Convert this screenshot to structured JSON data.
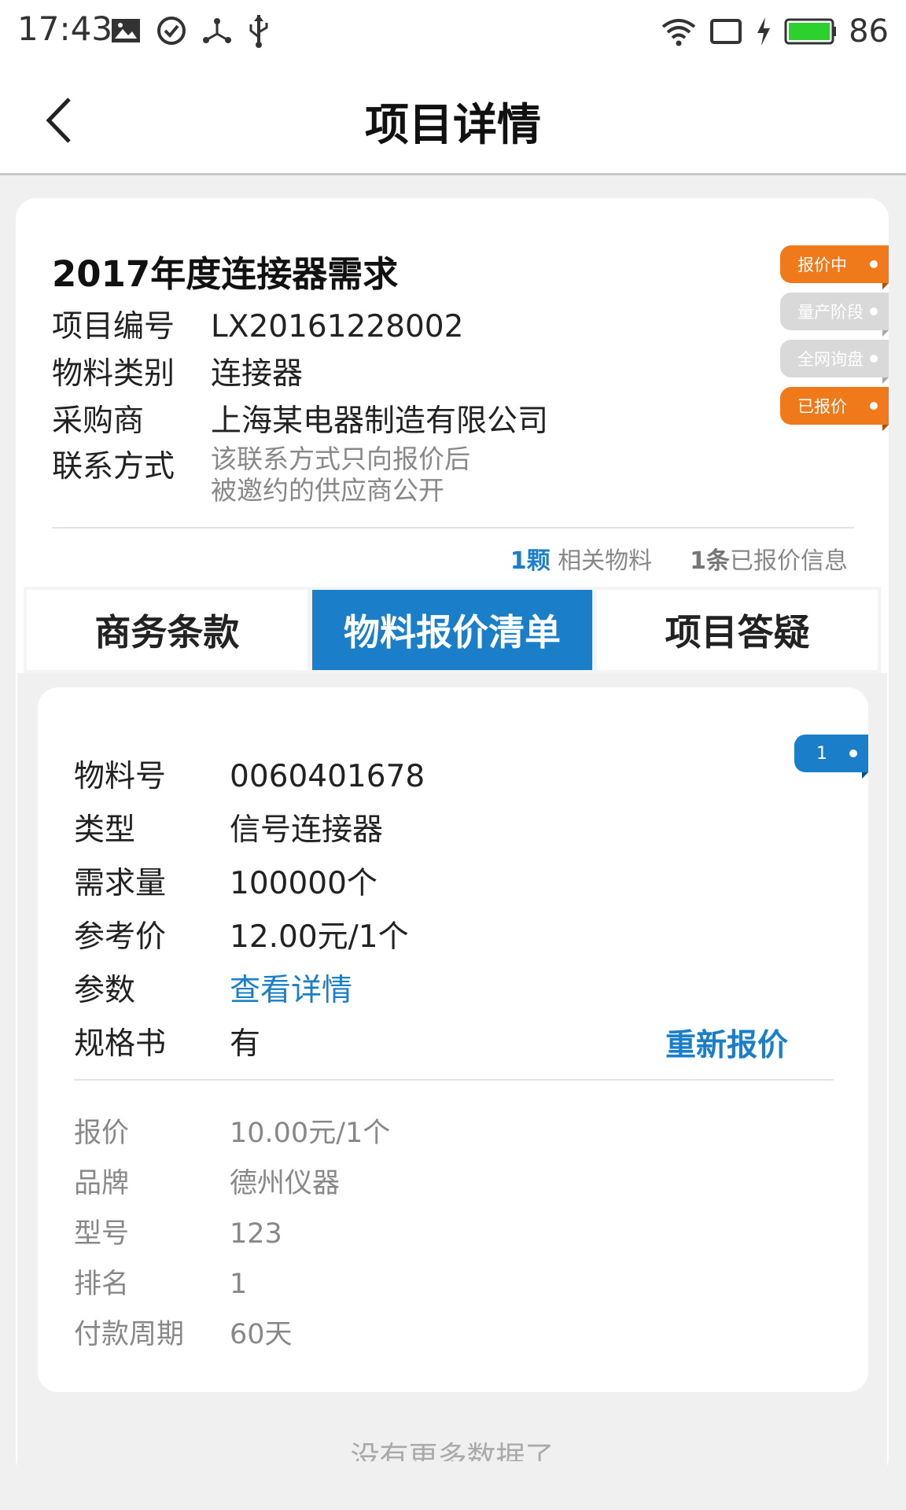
{
  "status_bar": {
    "time": "17:43",
    "battery": "86",
    "icons_left": [
      "image-icon",
      "check-circle-icon",
      "share-icon",
      "usb-icon"
    ],
    "icons_right": [
      "wifi-icon",
      "cast-icon",
      "charging-icon",
      "battery-icon"
    ]
  },
  "nav": {
    "title": "项目详情"
  },
  "project": {
    "title": "2017年度连接器需求",
    "rows": [
      {
        "label": "项目编号",
        "value": "LX20161228002"
      },
      {
        "label": "物料类别",
        "value": "连接器"
      },
      {
        "label": "采购商",
        "value": "上海某电器制造有限公司"
      },
      {
        "label": "联系方式",
        "value": ""
      }
    ],
    "contact_note_1": "该联系方式只向报价后",
    "contact_note_2": "被邀约的供应商公开",
    "count_materials_num": "1颗",
    "count_materials_label": "相关物料",
    "count_quotes_num": "1条",
    "count_quotes_label": "已报价信息"
  },
  "tags": [
    {
      "label": "报价中",
      "color": "#f07a1a",
      "active": true
    },
    {
      "label": "量产阶段",
      "color": "#d9d9d9",
      "active": false
    },
    {
      "label": "全网询盘",
      "color": "#d9d9d9",
      "active": false
    },
    {
      "label": "已报价",
      "color": "#f07a1a",
      "active": true
    }
  ],
  "tabs": [
    {
      "label": "商务条款",
      "active": false
    },
    {
      "label": "物料报价清单",
      "active": true
    },
    {
      "label": "项目答疑",
      "active": false
    }
  ],
  "material": {
    "rank_badge": "1",
    "rows": [
      {
        "label": "物料号",
        "value": "0060401678"
      },
      {
        "label": "类型",
        "value": "信号连接器"
      },
      {
        "label": "需求量",
        "value": "100000个"
      },
      {
        "label": "参考价",
        "value": "12.00元/1个"
      },
      {
        "label": "参数",
        "value": "查看详情"
      },
      {
        "label": "规格书",
        "value": "有"
      }
    ],
    "requote_label": "重新报价",
    "quote_rows": [
      {
        "label": "报价",
        "value": "10.00元/1个"
      },
      {
        "label": "品牌",
        "value": "德州仪器"
      },
      {
        "label": "型号",
        "value": "123"
      },
      {
        "label": "排名",
        "value": "1"
      },
      {
        "label": "付款周期",
        "value": "60天"
      }
    ]
  },
  "footer": {
    "no_more": "没有更多数据了"
  },
  "colors": {
    "accent": "#1a7fc8",
    "orange": "#f07a1a",
    "background": "#f0f0f0"
  }
}
